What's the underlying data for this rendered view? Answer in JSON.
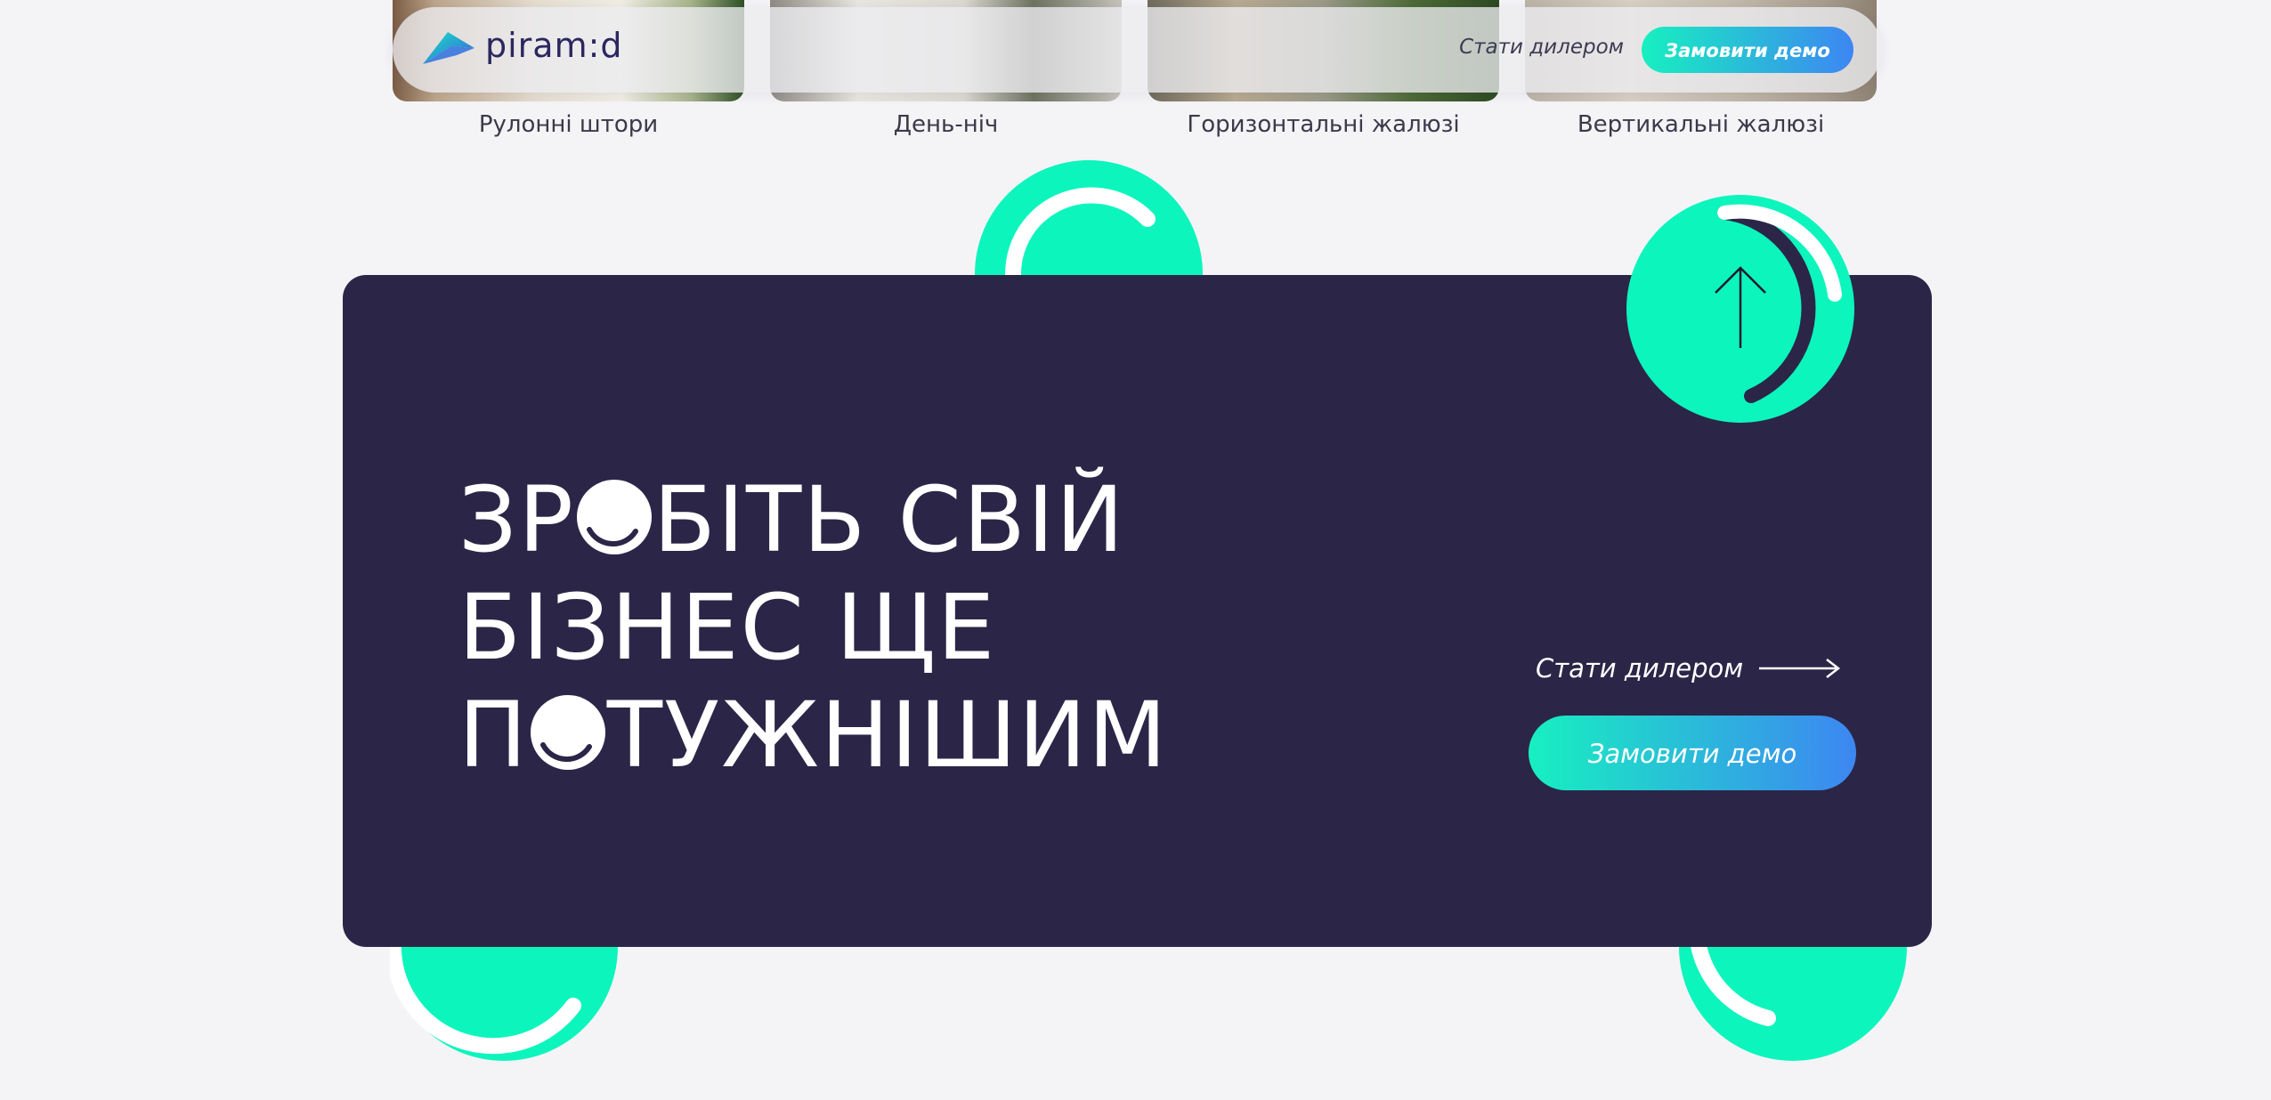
{
  "header": {
    "logo_text": "piram:d",
    "dealer_link": "Стати дилером",
    "demo_button": "Замовити демо"
  },
  "products": [
    {
      "label": "Рулонні штори"
    },
    {
      "label": "День-ніч"
    },
    {
      "label": "Горизонтальні жалюзі"
    },
    {
      "label": "Вертикальні жалюзі"
    }
  ],
  "cta": {
    "headline_line1_a": "ЗР",
    "headline_line1_b": "БІТЬ СВІЙ",
    "headline_line2": "БІЗНЕС ЩЕ",
    "headline_line3_a": "П",
    "headline_line3_b": "ТУЖНІШИМ",
    "dealer_link": "Стати дилером",
    "demo_button": "Замовити демо"
  },
  "icons": {
    "scroll_top": "arrow-up-icon",
    "dealer_arrow": "arrow-right-icon",
    "logo": "piramid-logo-icon"
  },
  "colors": {
    "accent_mint": "#0cf5bd",
    "banner_bg": "#2b2647",
    "gradient_start": "#17f0c0",
    "gradient_end": "#3d86f2",
    "page_bg": "#f4f4f7"
  }
}
